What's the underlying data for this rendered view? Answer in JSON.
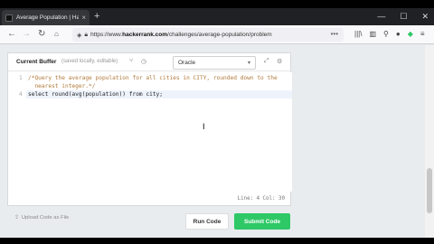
{
  "browser": {
    "tab_title": "Average Population | HackerR",
    "tab_close": "×",
    "new_tab": "+",
    "win_min": "—",
    "win_max": "☐",
    "win_close": "✕",
    "back": "←",
    "forward": "→",
    "reload": "↻",
    "url_prefix": "https://www.",
    "url_host": "hackerrank.com",
    "url_path": "/challenges/average-population/problem",
    "url_more": "•••"
  },
  "editor": {
    "buffer_title": "Current Buffer",
    "buffer_subtitle": "(saved locally, editable)",
    "language": "Oracle",
    "lines": [
      {
        "num": "1",
        "text": "/*Query the average population for all cities in CITY, rounded down to the"
      },
      {
        "num": "",
        "text": "  nearest integer.*/"
      },
      {
        "num": "4",
        "text": "select round(avg(population)) from city;"
      }
    ],
    "status": "Line: 4 Col: 30"
  },
  "actions": {
    "upload": "Upload Code as File",
    "run": "Run Code",
    "submit": "Submit Code"
  },
  "colors": {
    "accent": "#2ec866",
    "comment": "#b07a3a"
  }
}
